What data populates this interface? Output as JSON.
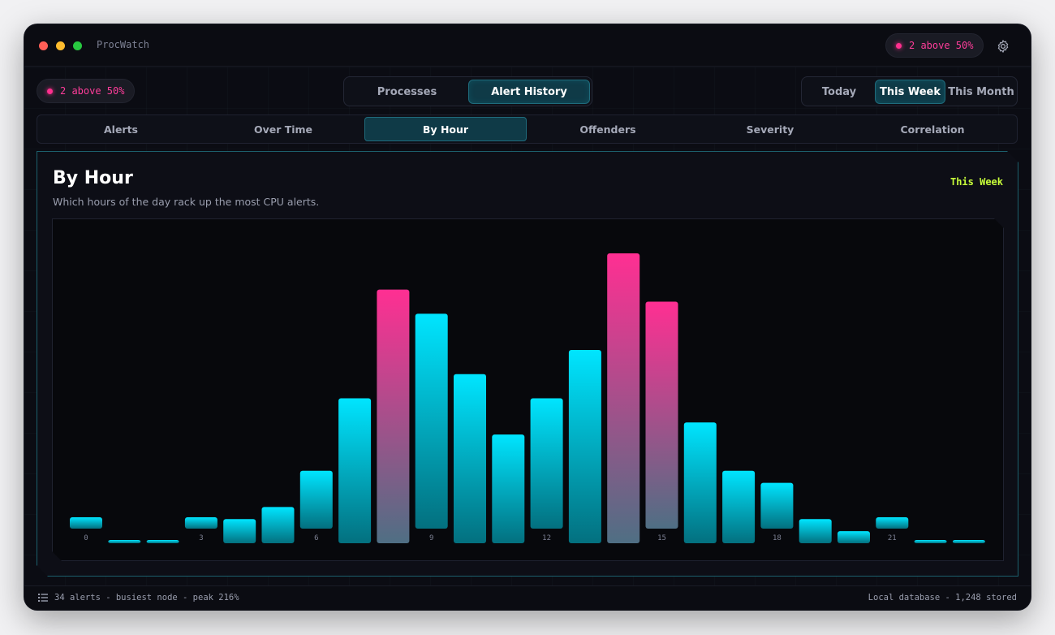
{
  "app": {
    "title": "ProcWatch"
  },
  "alert_pill": {
    "label": "2 above 50%"
  },
  "main_tabs": [
    {
      "label": "Processes",
      "active": false
    },
    {
      "label": "Alert History",
      "active": true
    }
  ],
  "range_tabs": [
    {
      "label": "Today",
      "active": false
    },
    {
      "label": "This Week",
      "active": true
    },
    {
      "label": "This Month",
      "active": false
    }
  ],
  "sub_tabs": [
    {
      "label": "Alerts",
      "active": false
    },
    {
      "label": "Over Time",
      "active": false
    },
    {
      "label": "By Hour",
      "active": true
    },
    {
      "label": "Offenders",
      "active": false
    },
    {
      "label": "Severity",
      "active": false
    },
    {
      "label": "Correlation",
      "active": false
    }
  ],
  "panel": {
    "title": "By Hour",
    "subtitle": "Which hours of the day rack up the most CPU alerts.",
    "range_label": "This Week"
  },
  "colors": {
    "accent": "#00e5ff",
    "hot": "#ff2f8e",
    "lime": "#c8ff3a"
  },
  "chart_data": {
    "type": "bar",
    "categories": [
      "0",
      "1",
      "2",
      "3",
      "4",
      "5",
      "6",
      "7",
      "8",
      "9",
      "10",
      "11",
      "12",
      "13",
      "14",
      "15",
      "16",
      "17",
      "18",
      "19",
      "20",
      "21",
      "22",
      "23"
    ],
    "tick_labels": [
      "0",
      "",
      "",
      "3",
      "",
      "",
      "6",
      "",
      "",
      "9",
      "",
      "",
      "12",
      "",
      "",
      "15",
      "",
      "",
      "18",
      "",
      "",
      "21",
      "",
      ""
    ],
    "values": [
      1,
      0.1,
      0.1,
      1,
      2,
      3,
      6,
      12,
      21,
      19,
      14,
      9,
      12,
      16,
      24,
      20,
      10,
      6,
      5,
      2,
      1,
      1,
      0.1,
      0.1
    ],
    "highlight": [
      8,
      14,
      15
    ],
    "ylim": [
      0,
      24
    ],
    "grid": false
  },
  "status": {
    "left": "34 alerts - busiest node - peak 216%",
    "right": "Local database - 1,248 stored"
  }
}
